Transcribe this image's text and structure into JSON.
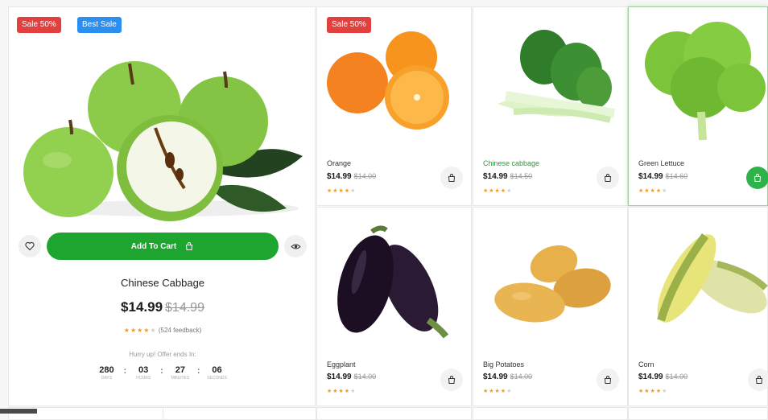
{
  "featured": {
    "badges": {
      "sale": "Sale 50%",
      "best": "Best Sale"
    },
    "add_to_cart_label": "Add To Cart",
    "name": "Chinese Cabbage",
    "price": "$14.99",
    "old_price": "$14.99",
    "rating": 4,
    "stars_text": "★★★★",
    "stars_empty_text": "★",
    "feedback": "(524 feedback)",
    "hurry_text": "Hurry up! Offer ends In:",
    "countdown": [
      {
        "value": "280",
        "label": "DAYS"
      },
      {
        "value": "03",
        "label": "HOURS"
      },
      {
        "value": "27",
        "label": "MINUTES"
      },
      {
        "value": "06",
        "label": "SECONDS"
      }
    ],
    "icons": {
      "wishlist": "heart-icon",
      "quick_view": "eye-icon",
      "cart": "bag-icon"
    }
  },
  "products": [
    {
      "name": "Orange",
      "price": "$14.99",
      "old_price": "$14.00",
      "rating": 4,
      "stars_text": "★★★★",
      "stars_empty_text": "★",
      "badge": "Sale 50%",
      "highlight": false
    },
    {
      "name": "Chinese cabbage",
      "price": "$14.99",
      "old_price": "$14.50",
      "rating": 4,
      "stars_text": "★★★★",
      "stars_empty_text": "★",
      "badge": "",
      "highlight": true
    },
    {
      "name": "Green Lettuce",
      "price": "$14.99",
      "old_price": "$14.60",
      "rating": 4,
      "stars_text": "★★★★",
      "stars_empty_text": "★",
      "badge": "",
      "highlight": false
    },
    {
      "name": "Eggplant",
      "price": "$14.99",
      "old_price": "$14.00",
      "rating": 4,
      "stars_text": "★★★★",
      "stars_empty_text": "★",
      "badge": "",
      "highlight": false
    },
    {
      "name": "Big Potatoes",
      "price": "$14.99",
      "old_price": "$14.00",
      "rating": 4,
      "stars_text": "★★★★",
      "stars_empty_text": "★",
      "badge": "",
      "highlight": false
    },
    {
      "name": "Corn",
      "price": "$14.99",
      "old_price": "$14.00",
      "rating": 4,
      "stars_text": "★★★★",
      "stars_empty_text": "★",
      "badge": "",
      "highlight": false
    }
  ],
  "colors": {
    "accent_green": "#1ea530",
    "sale_red": "#e23f3f",
    "best_blue": "#2c8ff0",
    "star_orange": "#f29a1f"
  }
}
